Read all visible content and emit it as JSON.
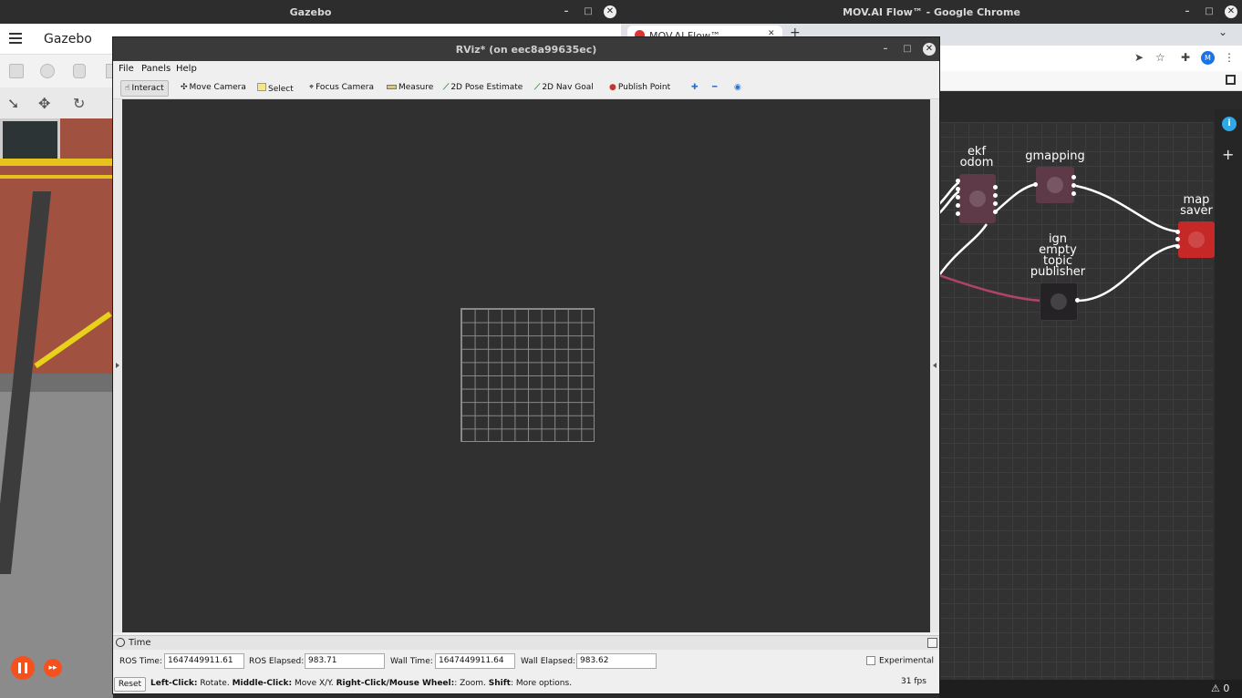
{
  "gazebo": {
    "window_title": "Gazebo",
    "app_title": "Gazebo",
    "min": "–",
    "max": "□",
    "close": "✕",
    "step_icon": "▸▸"
  },
  "chrome": {
    "window_title": "MOV.AI Flow™ - Google Chrome",
    "tab_title": "MOV.AI Flow™",
    "tab_close": "✕",
    "new_tab": "+",
    "dropdown": "⌄",
    "avatar": "M",
    "min": "–",
    "max": "□",
    "close": "✕",
    "status_warning_count": "0"
  },
  "flow": {
    "nodes": [
      {
        "id": "ekf",
        "label_line1": "ekf",
        "label_line2": "odom",
        "color": "#5e3a48"
      },
      {
        "id": "gmapping",
        "label_line1": "gmapping",
        "label_line2": "",
        "color": "#5e3a48"
      },
      {
        "id": "map",
        "label_line1": "map",
        "label_line2": "saver",
        "color": "#c62828"
      },
      {
        "id": "ign",
        "label_line1": "ign",
        "label_line2": "empty",
        "label_line3": "topic",
        "label_line4": "publisher",
        "color": "#252225"
      }
    ],
    "wire_color": "#ffffff",
    "highlight_wire_color": "#b04368"
  },
  "rviz": {
    "window_title": "RViz* (on eec8a99635ec)",
    "min": "–",
    "max": "□",
    "close": "✕",
    "menu": {
      "file": "File",
      "panels": "Panels",
      "help": "Help"
    },
    "toolbar": {
      "interact": "Interact",
      "move_camera": "Move Camera",
      "select": "Select",
      "focus_camera": "Focus Camera",
      "measure": "Measure",
      "pose_estimate": "2D Pose Estimate",
      "nav_goal": "2D Nav Goal",
      "publish_point": "Publish Point"
    },
    "time_panel": {
      "title": "Time",
      "ros_time_label": "ROS Time:",
      "ros_time": "1647449911.61",
      "ros_elapsed_label": "ROS Elapsed:",
      "ros_elapsed": "983.71",
      "wall_time_label": "Wall Time:",
      "wall_time": "1647449911.64",
      "wall_elapsed_label": "Wall Elapsed:",
      "wall_elapsed": "983.62",
      "experimental_label": "Experimental"
    },
    "status": {
      "reset": "Reset",
      "left_click": "Left-Click:",
      "left_click_desc": " Rotate. ",
      "middle_click": "Middle-Click:",
      "middle_click_desc": " Move X/Y. ",
      "right_click": "Right-Click/Mouse Wheel:",
      "right_click_desc": ": Zoom. ",
      "shift": "Shift",
      "shift_desc": ": More options.",
      "fps": "31 fps"
    }
  }
}
